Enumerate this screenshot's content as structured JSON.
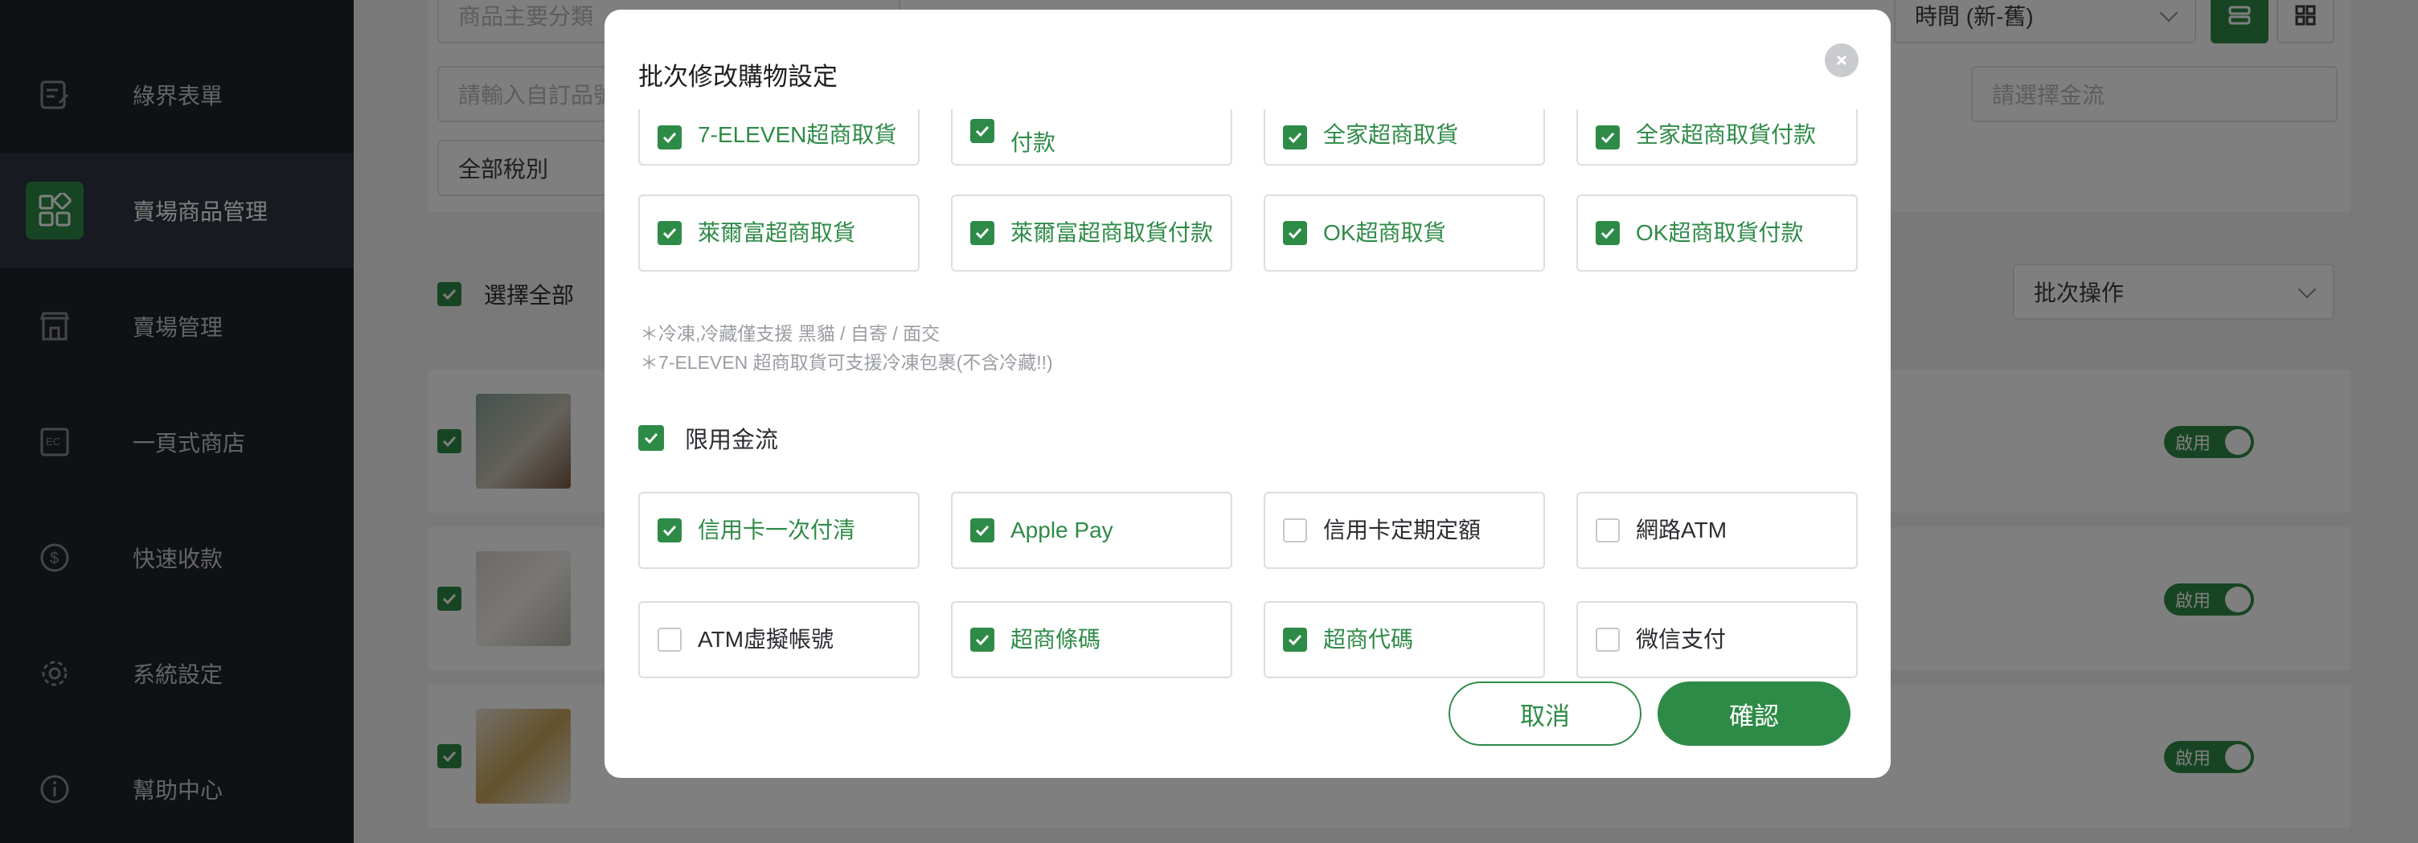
{
  "sidebar": {
    "items": [
      {
        "label": "綠界表單",
        "icon": "form-icon"
      },
      {
        "label": "賣場商品管理",
        "icon": "products-icon"
      },
      {
        "label": "賣場管理",
        "icon": "store-icon"
      },
      {
        "label": "一頁式商店",
        "icon": "ec-shop-icon"
      },
      {
        "label": "快速收款",
        "icon": "dollar-icon"
      },
      {
        "label": "系統設定",
        "icon": "gear-icon"
      },
      {
        "label": "幫助中心",
        "icon": "info-icon"
      }
    ],
    "active_index": 1
  },
  "filters": {
    "category_placeholder": "商品主要分類",
    "sort_value": "時間 (新-舊)",
    "order_input_placeholder": "請輸入自訂品號",
    "payment_placeholder": "請選擇金流",
    "tax_value": "全部稅別"
  },
  "list": {
    "select_all_label": "選擇全部",
    "batch_action_label": "批次操作",
    "toggle_label": "啟用"
  },
  "modal": {
    "title": "批次修改購物設定",
    "logistics_partial": [
      {
        "label": "7-ELEVEN超商取貨",
        "checked": true
      },
      {
        "label": "付款",
        "checked": true
      },
      {
        "label": "全家超商取貨",
        "checked": true
      },
      {
        "label": "全家超商取貨付款",
        "checked": true
      }
    ],
    "logistics": [
      {
        "label": "萊爾富超商取貨",
        "checked": true
      },
      {
        "label": "萊爾富超商取貨付款",
        "checked": true
      },
      {
        "label": "OK超商取貨",
        "checked": true
      },
      {
        "label": "OK超商取貨付款",
        "checked": true
      }
    ],
    "notes": [
      "＊冷凍,冷藏僅支援 黑貓 / 自寄 / 面交",
      "＊7-ELEVEN 超商取貨可支援冷凍包裹(不含冷藏!!)"
    ],
    "payment_section_label": "限用金流",
    "payment_section_checked": true,
    "payments": [
      {
        "label": "信用卡一次付清",
        "checked": true
      },
      {
        "label": "Apple Pay",
        "checked": true
      },
      {
        "label": "信用卡定期定額",
        "checked": false
      },
      {
        "label": "網路ATM",
        "checked": false
      },
      {
        "label": "ATM虛擬帳號",
        "checked": false
      },
      {
        "label": "超商條碼",
        "checked": true
      },
      {
        "label": "超商代碼",
        "checked": true
      },
      {
        "label": "微信支付",
        "checked": false
      }
    ],
    "cancel_label": "取消",
    "confirm_label": "確認"
  },
  "colors": {
    "accent": "#2e8b47",
    "sidebar_bg": "#1f232a"
  }
}
